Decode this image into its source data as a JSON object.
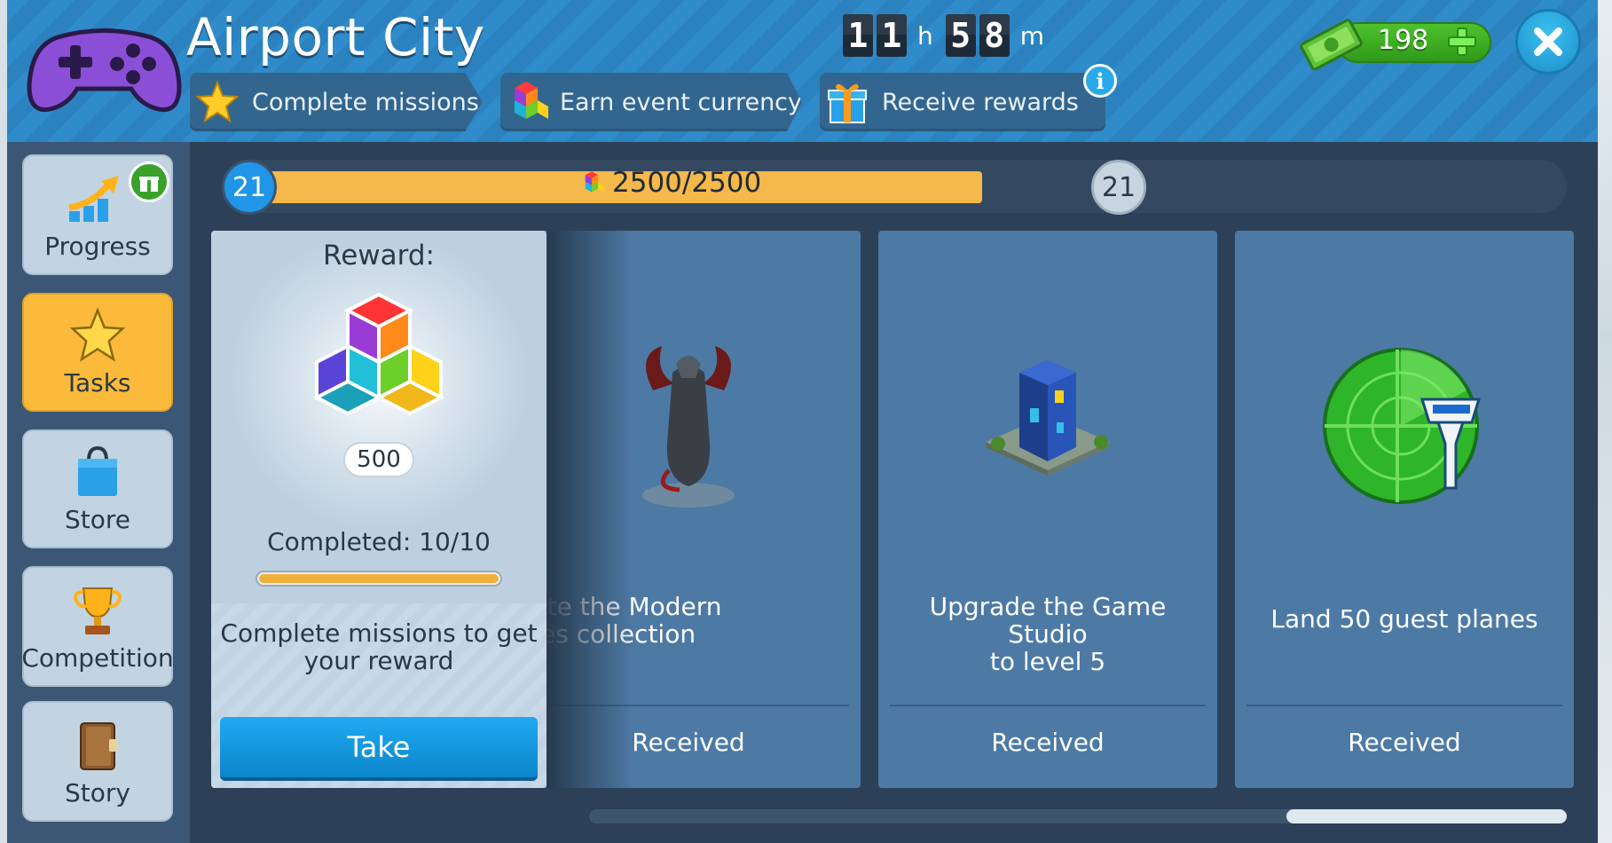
{
  "header": {
    "title": "Airport City",
    "steps": [
      {
        "label": "Complete missions",
        "icon": "star-icon"
      },
      {
        "label": "Earn event currency",
        "icon": "cube-currency-icon"
      },
      {
        "label": "Receive rewards",
        "icon": "gift-icon"
      }
    ],
    "timer": {
      "hours_digits": [
        "1",
        "1"
      ],
      "hours_unit": "h",
      "minutes_digits": [
        "5",
        "8"
      ],
      "minutes_unit": "m"
    },
    "currency": {
      "value": "198",
      "icon": "cash-icon"
    }
  },
  "sidebar": {
    "items": [
      {
        "label": "Progress",
        "icon": "progress-arrow-icon",
        "active": false
      },
      {
        "label": "Tasks",
        "icon": "star-icon",
        "active": true
      },
      {
        "label": "Store",
        "icon": "shopping-bag-icon",
        "active": false
      },
      {
        "label": "Competition",
        "icon": "trophy-icon",
        "active": false
      },
      {
        "label": "Story",
        "icon": "book-icon",
        "active": false
      }
    ]
  },
  "progress": {
    "level_current": "21",
    "level_next": "21",
    "text": "2500/2500",
    "fraction": 1.0
  },
  "reward": {
    "title": "Reward:",
    "amount": "500",
    "completed_text": "Completed: 10/10",
    "completed_fraction": 1.0,
    "description": "Complete missions to get your reward",
    "button": "Take"
  },
  "missions": [
    {
      "title": "nplete the Modern Heroes collection",
      "line1": "nplete the Modern",
      "line2": "leroes collection",
      "status": "Received",
      "icon": "dragon-statue-icon"
    },
    {
      "title": "Upgrade the Game Studio to level 5",
      "line1": "Upgrade the Game Studio",
      "line2": "to level 5",
      "status": "Received",
      "icon": "skyscraper-icon"
    },
    {
      "title": "Land 50 guest planes",
      "line1": "Land 50 guest planes",
      "line2": "",
      "status": "Received",
      "icon": "radar-tower-icon"
    }
  ],
  "colors": {
    "header_blue": "#2f8bc9",
    "active_tab": "#fbba3a",
    "progress_fill": "#f5b84a",
    "mission_card": "#4d7aa5",
    "take_button": "#0b86cc"
  }
}
